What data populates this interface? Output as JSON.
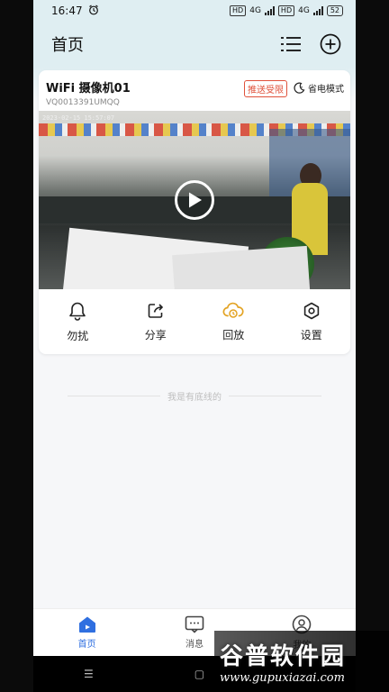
{
  "status_bar": {
    "time": "16:47",
    "network_1": "4G",
    "network_2": "4G",
    "hd_1": "HD",
    "hd_2": "HD",
    "battery": "52"
  },
  "header": {
    "title": "首页"
  },
  "device_card": {
    "name": "WiFi 摄像机01",
    "device_id": "VQ0013391UMQQ",
    "push_tag": "推送受限",
    "power_mode": "省电模式",
    "video_timestamp": "2023-02-15 15:57:07",
    "actions": [
      {
        "label": "勿扰",
        "icon": "bell-icon"
      },
      {
        "label": "分享",
        "icon": "share-icon"
      },
      {
        "label": "回放",
        "icon": "cloud-playback-icon"
      },
      {
        "label": "设置",
        "icon": "settings-icon"
      }
    ]
  },
  "footer_note": "我是有底线的",
  "tabbar": {
    "items": [
      {
        "label": "首页",
        "active": true
      },
      {
        "label": "消息",
        "active": false
      },
      {
        "label": "我的",
        "active": false
      }
    ]
  },
  "navbar": {
    "menu": "☰",
    "home": "▢"
  },
  "watermark": {
    "title": "谷普软件园",
    "url": "www.gupuxiazai.com"
  },
  "colors": {
    "accent": "#2f6fe0",
    "push_tag": "#e0523b",
    "playback_icon": "#e3a323",
    "header_bg": "#dfeef2"
  }
}
